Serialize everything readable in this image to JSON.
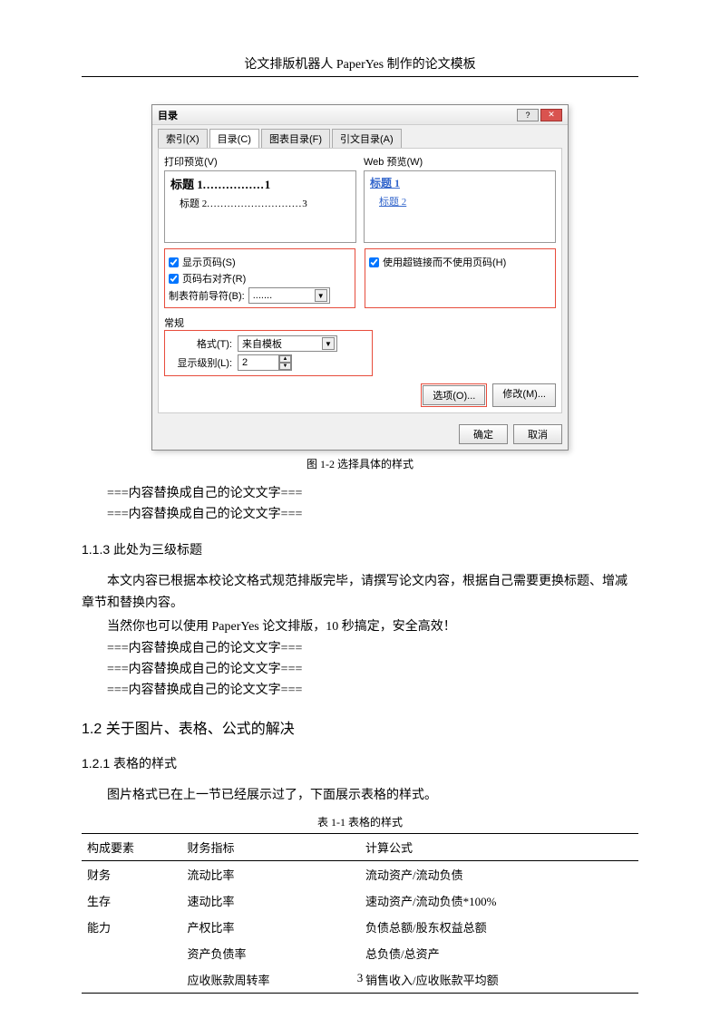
{
  "header": "论文排版机器人 PaperYes 制作的论文模板",
  "dialog": {
    "title": "目录",
    "tabs": [
      "索引(X)",
      "目录(C)",
      "图表目录(F)",
      "引文目录(A)"
    ],
    "active_tab": 1,
    "print_preview_label": "打印预览(V)",
    "web_preview_label": "Web 预览(W)",
    "print_h1": "标题 1",
    "print_h1_page": "1",
    "print_h2": "标题 2",
    "print_h2_page": "3",
    "web_h1": "标题 1",
    "web_h2": "标题 2",
    "chk_show_page": "显示页码(S)",
    "chk_right_align": "页码右对齐(R)",
    "leader_label": "制表符前导符(B):",
    "leader_value": ".......",
    "chk_hyperlink": "使用超链接而不使用页码(H)",
    "general_label": "常规",
    "format_label": "格式(T):",
    "format_value": "来自模板",
    "level_label": "显示级别(L):",
    "level_value": "2",
    "btn_options": "选项(O)...",
    "btn_modify": "修改(M)...",
    "btn_ok": "确定",
    "btn_cancel": "取消"
  },
  "fig_caption": "图 1-2  选择具体的样式",
  "placeholder1": "===内容替换成自己的论文文字===",
  "placeholder2": "===内容替换成自己的论文文字===",
  "h3_113": "1.1.3  此处为三级标题",
  "para1": "本文内容已根据本校论文格式规范排版完毕，请撰写论文内容，根据自己需要更换标题、增减章节和替换内容。",
  "para2": "当然你也可以使用 PaperYes 论文排版，10 秒搞定，安全高效！",
  "placeholder3": "===内容替换成自己的论文文字===",
  "placeholder4": "===内容替换成自己的论文文字===",
  "placeholder5": "===内容替换成自己的论文文字===",
  "h2_12": "1.2  关于图片、表格、公式的解决",
  "h3_121": "1.2.1  表格的样式",
  "para3": "图片格式已在上一节已经展示过了，下面展示表格的样式。",
  "tbl_caption": "表 1-1  表格的样式",
  "chart_data": {
    "type": "table",
    "columns": [
      "构成要素",
      "财务指标",
      "计算公式"
    ],
    "rows": [
      [
        "财务",
        "流动比率",
        "流动资产/流动负债"
      ],
      [
        "生存",
        "速动比率",
        "速动资产/流动负债*100%"
      ],
      [
        "能力",
        "产权比率",
        "负债总额/股东权益总额"
      ],
      [
        "",
        "资产负债率",
        "总负债/总资产"
      ],
      [
        "",
        "应收账款周转率",
        "销售收入/应收账款平均额"
      ]
    ]
  },
  "page_number": "3"
}
